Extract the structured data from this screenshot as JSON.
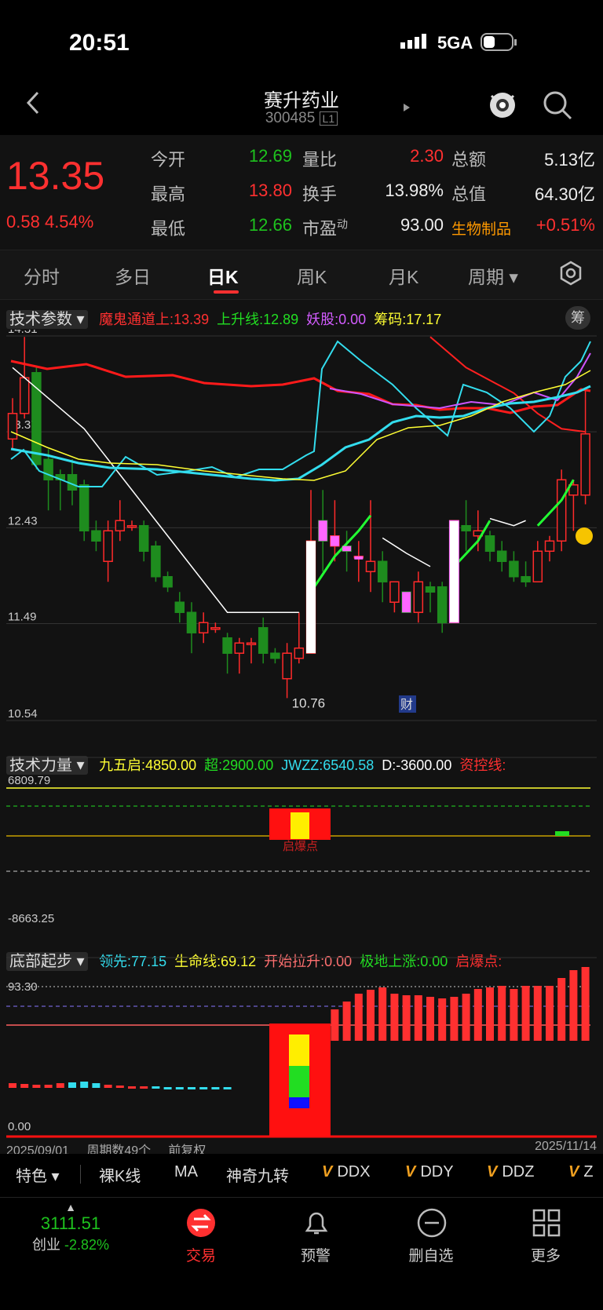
{
  "status": {
    "time": "20:51",
    "network": "5GA"
  },
  "header": {
    "title": "赛升药业",
    "code": "300485",
    "level": "L1"
  },
  "quote": {
    "price": "13.35",
    "change": "0.58",
    "change_pct": "4.54%",
    "rows": [
      [
        {
          "k": "今开",
          "v": "12.69",
          "c": "#1ec21e"
        },
        {
          "k": "量比",
          "v": "2.30",
          "c": "#ff3030"
        },
        {
          "k": "总额",
          "v": "5.13亿",
          "c": "#eee"
        }
      ],
      [
        {
          "k": "最高",
          "v": "13.80",
          "c": "#ff3030"
        },
        {
          "k": "换手",
          "v": "13.98%",
          "c": "#eee"
        },
        {
          "k": "总值",
          "v": "64.30亿",
          "c": "#eee"
        }
      ],
      [
        {
          "k": "最低",
          "v": "12.66",
          "c": "#1ec21e"
        },
        {
          "k": "市盈",
          "v": "93.00",
          "c": "#eee"
        },
        {
          "k": "生物制品",
          "v": "+0.51%",
          "c": "#ff3030"
        }
      ]
    ],
    "pe_sup": "动"
  },
  "tabs": [
    "分时",
    "多日",
    "日K",
    "周K",
    "月K",
    "周期"
  ],
  "active_tab": "日K",
  "panel1": {
    "selector": "技术参数",
    "items": [
      {
        "t": "魔鬼通道上:13.39",
        "c": "#ff3030"
      },
      {
        "t": "上升线:12.89",
        "c": "#22dd22"
      },
      {
        "t": "妖股:0.00",
        "c": "#d35cff"
      },
      {
        "t": "筹码:17.17",
        "c": "#ffff33"
      }
    ],
    "badge": "筹",
    "yticks": [
      "14.31",
      "13.37",
      "12.43",
      "11.49",
      "10.54"
    ],
    "low_label": "10.76",
    "cai": "财"
  },
  "panel2": {
    "selector": "技术力量",
    "items": [
      {
        "t": "九五启:4850.00",
        "c": "#ffff33"
      },
      {
        "t": "超:2900.00",
        "c": "#22dd22"
      },
      {
        "t": "JWZZ:6540.58",
        "c": "#33ddee"
      },
      {
        "t": "D:-3600.00",
        "c": "#ffffff"
      },
      {
        "t": "资控线:",
        "c": "#ff3030"
      }
    ],
    "yticks": [
      "6809.79",
      "-8663.25"
    ],
    "note": "启爆点"
  },
  "panel3": {
    "selector": "底部起步",
    "items": [
      {
        "t": "领先:77.15",
        "c": "#33ddee"
      },
      {
        "t": "生命线:69.12",
        "c": "#ffff33"
      },
      {
        "t": "开始拉升:0.00",
        "c": "#ff7070"
      },
      {
        "t": "极地上涨:0.00",
        "c": "#22dd22"
      },
      {
        "t": "启爆点:",
        "c": "#ff3030"
      }
    ],
    "yticks": [
      "93.30",
      "0.00"
    ]
  },
  "axis": {
    "start": "2025/09/01",
    "count": "周期数49个",
    "adj": "前复权",
    "end": "2025/11/14"
  },
  "features": {
    "first": "特色",
    "items": [
      "裸K线",
      "MA",
      "神奇九转",
      "DDX",
      "DDY",
      "DDZ",
      "Z"
    ]
  },
  "index": {
    "value": "3111.51",
    "name": "创业",
    "chg": "-2.82%"
  },
  "nav": [
    "交易",
    "预警",
    "删自选",
    "更多"
  ],
  "chart_data": {
    "type": "candlestick",
    "candles": [
      [
        13.3,
        13.55,
        13.7,
        13.2
      ],
      [
        13.55,
        13.9,
        14.3,
        13.5
      ],
      [
        13.95,
        13.05,
        14.0,
        13.0
      ],
      [
        13.1,
        12.9,
        13.2,
        12.6
      ],
      [
        12.95,
        12.9,
        13.0,
        12.6
      ],
      [
        12.95,
        12.8,
        13.1,
        12.65
      ],
      [
        12.85,
        12.4,
        12.9,
        12.3
      ],
      [
        12.4,
        12.3,
        12.5,
        12.2
      ],
      [
        12.1,
        12.4,
        12.5,
        11.9
      ],
      [
        12.4,
        12.5,
        12.7,
        12.3
      ],
      [
        12.45,
        12.45,
        12.5,
        12.4
      ],
      [
        12.45,
        12.2,
        12.5,
        12.1
      ],
      [
        12.25,
        11.95,
        12.3,
        11.9
      ],
      [
        11.95,
        11.85,
        12.0,
        11.8
      ],
      [
        11.7,
        11.6,
        11.8,
        11.5
      ],
      [
        11.6,
        11.4,
        11.7,
        11.2
      ],
      [
        11.4,
        11.5,
        11.6,
        11.3
      ],
      [
        11.45,
        11.45,
        11.5,
        11.4
      ],
      [
        11.35,
        11.2,
        11.4,
        11.0
      ],
      [
        11.2,
        11.3,
        11.35,
        11.0
      ],
      [
        11.3,
        11.3,
        11.35,
        11.1
      ],
      [
        11.45,
        11.2,
        11.55,
        11.1
      ],
      [
        11.2,
        11.15,
        11.25,
        11.1
      ],
      [
        10.95,
        11.2,
        11.3,
        10.76
      ],
      [
        11.15,
        11.25,
        11.6,
        11.1
      ],
      [
        11.2,
        12.3,
        12.8,
        11.2
      ],
      [
        12.5,
        12.3,
        12.8,
        12.0
      ],
      [
        12.25,
        12.35,
        12.7,
        12.1
      ],
      [
        12.25,
        12.2,
        12.4,
        12.0
      ],
      [
        12.15,
        12.15,
        12.3,
        11.9
      ],
      [
        12.0,
        12.1,
        12.7,
        11.8
      ],
      [
        12.1,
        11.9,
        12.2,
        11.7
      ],
      [
        11.7,
        11.9,
        11.9,
        11.6
      ],
      [
        11.8,
        11.6,
        11.8,
        11.6
      ],
      [
        11.6,
        11.9,
        12.0,
        11.5
      ],
      [
        11.85,
        11.8,
        11.9,
        11.6
      ],
      [
        11.85,
        11.5,
        11.9,
        11.4
      ],
      [
        11.5,
        12.5,
        12.5,
        11.5
      ],
      [
        12.45,
        12.4,
        12.7,
        12.2
      ],
      [
        12.35,
        12.4,
        12.6,
        12.2
      ],
      [
        12.35,
        12.2,
        12.4,
        12.1
      ],
      [
        12.2,
        12.1,
        12.3,
        12.0
      ],
      [
        12.1,
        11.95,
        12.2,
        11.9
      ],
      [
        11.95,
        11.9,
        12.1,
        11.85
      ],
      [
        11.9,
        12.2,
        12.3,
        11.9
      ],
      [
        12.2,
        12.3,
        12.35,
        12.1
      ],
      [
        12.3,
        12.9,
        13.0,
        12.2
      ],
      [
        12.75,
        12.85,
        12.9,
        12.4
      ],
      [
        12.75,
        13.35,
        13.8,
        12.66
      ]
    ]
  }
}
